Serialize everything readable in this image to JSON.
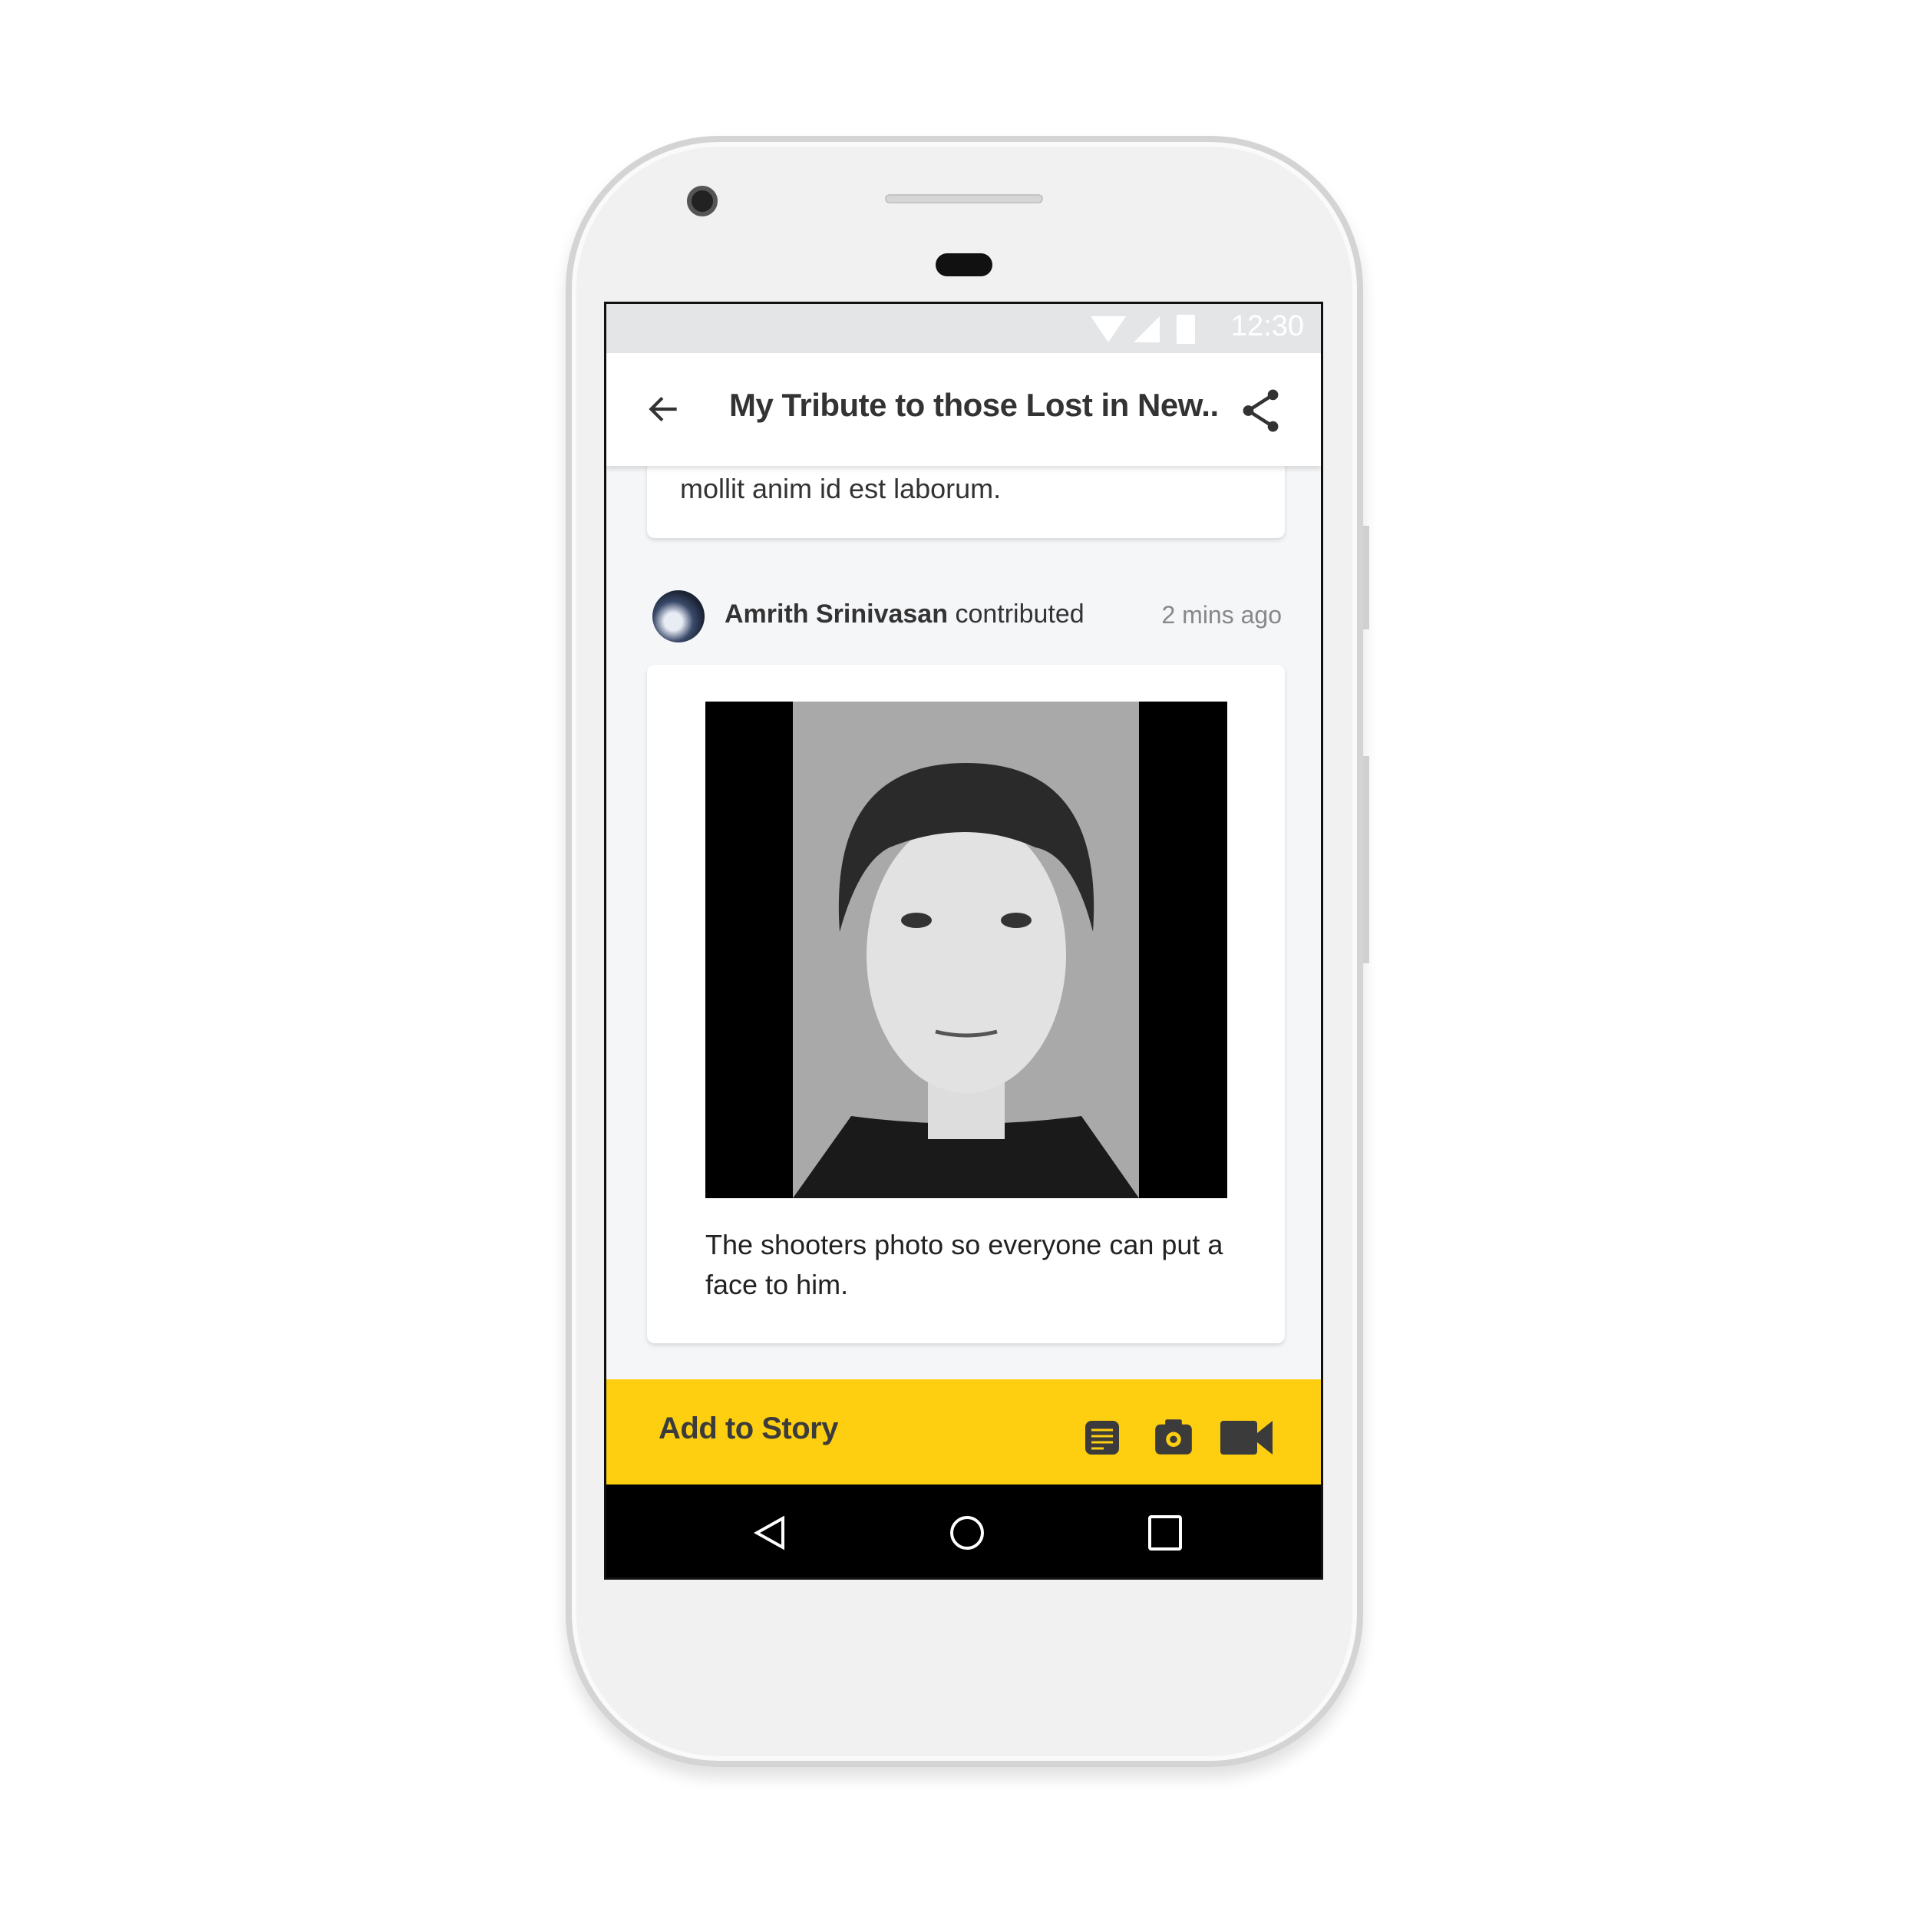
{
  "status_bar": {
    "time": "12:30",
    "icons": [
      "wifi-icon",
      "signal-icon",
      "battery-icon"
    ]
  },
  "app_bar": {
    "back_icon": "arrow-left-icon",
    "title": "My Tribute to those Lost in New..",
    "share_icon": "share-icon"
  },
  "previous_card": {
    "text": "mollit anim id est laborum."
  },
  "contribution": {
    "author": "Amrith Srinivasan",
    "action": "contributed",
    "time": "2 mins ago",
    "caption": "The shooters photo so everyone can put a face to him."
  },
  "add_bar": {
    "label": "Add to Story",
    "icons": [
      "text-note-icon",
      "camera-icon",
      "video-icon"
    ],
    "color": "#fecf10"
  },
  "nav_bar": {
    "icons": [
      "back-triangle-icon",
      "home-circle-icon",
      "recents-square-icon"
    ]
  }
}
